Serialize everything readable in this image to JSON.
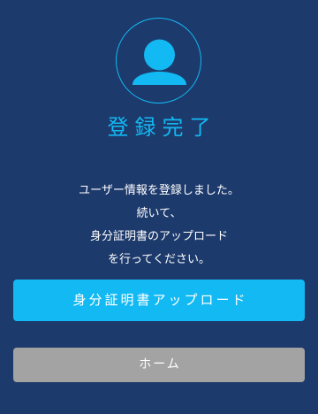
{
  "title": "登録完了",
  "icon": "user-avatar-icon",
  "message": {
    "lines": [
      "ユーザー情報を登録しました。",
      "続いて、",
      "身分証明書のアップロード",
      "を行ってください。"
    ]
  },
  "buttons": {
    "upload_label": "身分証明書アップロード",
    "home_label": "ホーム"
  },
  "colors": {
    "background": "#1d3a6c",
    "accent": "#12b9f3",
    "button_secondary": "#a3a3a3",
    "text": "#ffffff"
  }
}
